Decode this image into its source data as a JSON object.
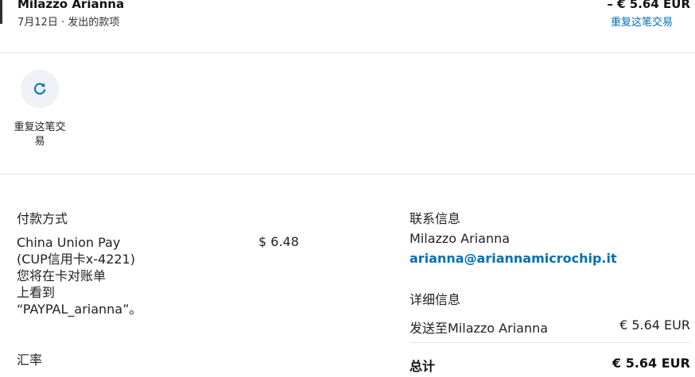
{
  "header": {
    "merchant_name": "Milazzo Arianna",
    "subline": "7月12日 · 发出的款项",
    "amount": "– € 5.64 EUR",
    "repeat_link": "重复这笔交易"
  },
  "actions": {
    "repeat_label": "重复这笔交易",
    "repeat_icon": "refresh-icon"
  },
  "payment": {
    "title": "付款方式",
    "description_lines": [
      "China Union Pay",
      "(CUP信用卡x-4221)",
      "您将在卡对账单",
      "上看到",
      "“PAYPAL_arianna”。"
    ],
    "amount": "$ 6.48"
  },
  "exchange": {
    "title": "汇率"
  },
  "contact": {
    "title": "联系信息",
    "name": "Milazzo Arianna",
    "email": "arianna@ariannamicrochip.it"
  },
  "details": {
    "title": "详细信息",
    "row_label": "发送至Milazzo Arianna",
    "row_value": "€ 5.64 EUR",
    "total_label": "总计",
    "total_value": "€ 5.64 EUR"
  },
  "colors": {
    "link": "#0070ba",
    "icon_bg": "#eef1f6",
    "divider": "#e3e3e3"
  }
}
